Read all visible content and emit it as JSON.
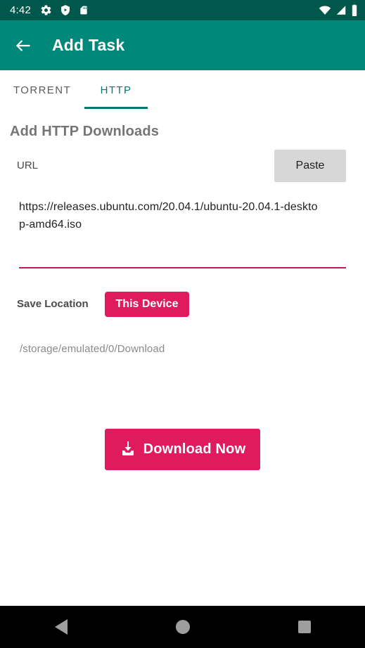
{
  "status_bar": {
    "time": "4:42",
    "left_icons": [
      "gear-icon",
      "shield-play-icon",
      "sd-card-icon"
    ],
    "right_icons": [
      "wifi-icon",
      "cell-signal-icon",
      "battery-icon"
    ],
    "background_color": "#00574b"
  },
  "app_bar": {
    "back_label": "back-arrow-icon",
    "title": "Add Task",
    "background_color": "#00897b"
  },
  "tabs": {
    "items": [
      {
        "label": "TORRENT",
        "active": false
      },
      {
        "label": "HTTP",
        "active": true
      }
    ],
    "active_color": "#00796b",
    "inactive_color": "#5c5c5c"
  },
  "main": {
    "section_title": "Add HTTP Downloads",
    "url": {
      "label": "URL",
      "value": "https://releases.ubuntu.com/20.04.1/ubuntu-20.04.1-desktop-amd64.iso",
      "placeholder": "",
      "underline_color": "#c2185b"
    },
    "paste_button": "Paste",
    "save_location": {
      "label": "Save Location",
      "button_label": "This Device",
      "path": "/storage/emulated/0/Download"
    },
    "download_button": {
      "label": "Download Now",
      "icon": "download-icon",
      "color": "#e01b5d"
    }
  },
  "nav_bar": {
    "items": [
      "back-nav-icon",
      "home-nav-icon",
      "recents-nav-icon"
    ],
    "background_color": "#000000"
  }
}
